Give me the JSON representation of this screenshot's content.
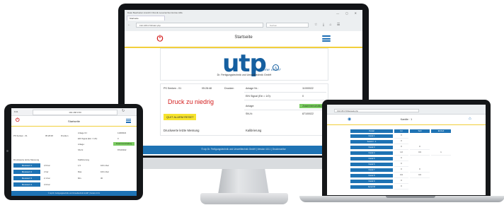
{
  "monitor": {
    "browser": {
      "menu_text": "Datei Bearbeiten Ansicht Chronik Lesezeichen Extras Hilfe",
      "tab_label": "Startseite",
      "address": "192.168.0.50/start.php",
      "search_placeholder": "Suchen",
      "window_controls": "— ◻ ✕",
      "toolbar_icons": "☆ ⤓ ⌂ ☰"
    },
    "app": {
      "title": "Startseite",
      "logo": {
        "wordmark": "utp",
        "registered": "®",
        "slogan": "just one order",
        "company": "Dr. Fertigungstechnik und Umwelttechnik GmbH"
      },
      "status_panel": {
        "ps_label": "PS Senken - 01",
        "time": "05:28:48",
        "mode": "Drucken",
        "alarm_text": "Druck zu niedrig",
        "quit_button": "QUIT ALARM RESET",
        "fields": [
          {
            "label": "Anlage Nr.:",
            "value": "11000022"
          },
          {
            "label": "EIN Signal (Ein = 1/0):",
            "value": "0"
          },
          {
            "label": "Anlage:",
            "value": "Zusammenschaltung"
          },
          {
            "label": "SN-N:",
            "value": "87100022"
          }
        ]
      },
      "sections": [
        "Druckwerte letzte Messung",
        "Kalibrierung"
      ],
      "footer": "© utp Dr. Fertigungstechnik und Umwelttechnik GmbH | Version 4.8.1 | Druckmonitor"
    }
  },
  "tablet": {
    "status_left": "9:41",
    "address": "192.168.0.50",
    "title": "Startseite",
    "info_labels": [
      "PS Senken - 01",
      "05:28:48",
      "Drucken"
    ],
    "right_fields": [
      {
        "label": "Anlage Nr.:",
        "value": "11000022"
      },
      {
        "label": "EIN Signal (Ein = 1/0):",
        "value": "0"
      },
      {
        "label": "Anlage:",
        "value": "Zusammenschaltung"
      },
      {
        "label": "SN-N:",
        "value": "87100022"
      }
    ],
    "sections": [
      "Druckwerte letzte Messung",
      "Kalibrierung"
    ],
    "rows": [
      {
        "name": "Messwert 1",
        "value": "3,5 bar",
        "cal": "1,5",
        "cal_val": "100 mbar"
      },
      {
        "name": "Messwert 2",
        "value": "2 bar",
        "cal": "Max.",
        "cal_val": "100 mbar"
      },
      {
        "name": "Messwert 3",
        "value": "2,1 bar",
        "cal": "Min.",
        "cal_val": "30"
      },
      {
        "name": "Messwert 4",
        "value": "3,9 bar",
        "cal": "",
        "cal_val": ""
      }
    ],
    "footer": "© utp Dr. Fertigungstechnik und Umwelttechnik GmbH | Version 4.8.1"
  },
  "laptop": {
    "address": "192.168.0.50/kanaele.php",
    "title": "Kanäle · 1",
    "headers": [
      "Kanal",
      "Ist",
      "Soll",
      "Einheit"
    ],
    "rows": [
      {
        "name": "Kanal 1",
        "ist": "0",
        "soll": "",
        "unit": ""
      },
      {
        "name": "Kanal 2 - 1",
        "ist": "0",
        "soll": "",
        "unit": ""
      },
      {
        "name": "Kanal 3",
        "ist": "0",
        "soll": "0",
        "unit": ""
      },
      {
        "name": "Kanal 4",
        "ist": "1,0",
        "soll": "0,9",
        "unit": "1"
      },
      {
        "name": "Kanal 5",
        "ist": "0",
        "soll": "",
        "unit": ""
      },
      {
        "name": "Kanal 6",
        "ist": "0",
        "soll": "",
        "unit": ""
      },
      {
        "name": "Kanal 7",
        "ist": "0",
        "soll": "0",
        "unit": ""
      },
      {
        "name": "Kanal 8",
        "ist": "0,9",
        "soll": "0,9",
        "unit": ""
      },
      {
        "name": "Kanal 9",
        "ist": "0",
        "soll": "",
        "unit": ""
      },
      {
        "name": "Kanal 10",
        "ist": "0",
        "soll": "",
        "unit": ""
      }
    ]
  },
  "colors": {
    "brand_blue": "#1e73b4",
    "accent_yellow": "#f2cf3b",
    "alarm_red": "#d42121",
    "ok_green": "#7ccc63"
  }
}
